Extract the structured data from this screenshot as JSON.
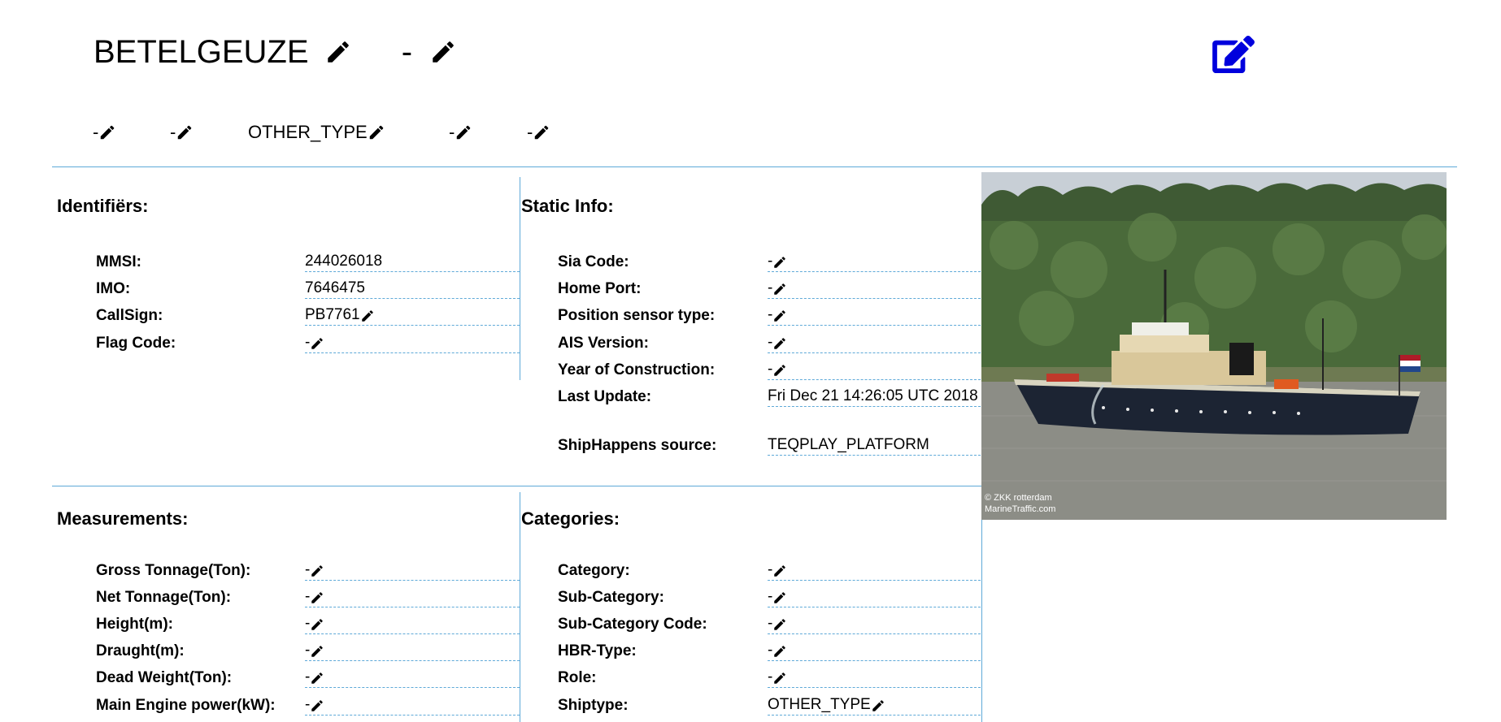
{
  "header": {
    "ship_name": "BETELGEUZE",
    "ship_name_suffix": "-"
  },
  "subheader": {
    "items": [
      {
        "value": "-"
      },
      {
        "value": "-"
      },
      {
        "value": "OTHER_TYPE"
      },
      {
        "value": "-"
      },
      {
        "value": "-"
      }
    ]
  },
  "identifiers": {
    "title": "Identifiërs:",
    "rows": [
      {
        "label": "MMSI:",
        "value": "244026018",
        "editable": false
      },
      {
        "label": "IMO:",
        "value": "7646475",
        "editable": false
      },
      {
        "label": "CallSign:",
        "value": "PB7761",
        "editable": true
      },
      {
        "label": "Flag Code:",
        "value": "-",
        "editable": true
      }
    ]
  },
  "static_info": {
    "title": "Static Info:",
    "rows": [
      {
        "label": "Sia Code:",
        "value": "-",
        "editable": true
      },
      {
        "label": "Home Port:",
        "value": "-",
        "editable": true
      },
      {
        "label": "Position sensor type:",
        "value": "-",
        "editable": true
      },
      {
        "label": "AIS Version:",
        "value": "-",
        "editable": true
      },
      {
        "label": "Year of Construction:",
        "value": "-",
        "editable": true
      },
      {
        "label": "Last Update:",
        "value": "Fri Dec 21 14:26:05 UTC 2018",
        "editable": false
      },
      {
        "label": "ShipHappens source:",
        "value": "TEQPLAY_PLATFORM",
        "editable": false
      }
    ]
  },
  "measurements": {
    "title": "Measurements:",
    "rows": [
      {
        "label": "Gross Tonnage(Ton):",
        "value": "-",
        "editable": true
      },
      {
        "label": "Net Tonnage(Ton):",
        "value": "-",
        "editable": true
      },
      {
        "label": "Height(m):",
        "value": "-",
        "editable": true
      },
      {
        "label": "Draught(m):",
        "value": "-",
        "editable": true
      },
      {
        "label": "Dead Weight(Ton):",
        "value": "-",
        "editable": true
      },
      {
        "label": "Main Engine power(kW):",
        "value": "-",
        "editable": true
      }
    ]
  },
  "categories": {
    "title": "Categories:",
    "rows": [
      {
        "label": "Category:",
        "value": "-",
        "editable": true
      },
      {
        "label": "Sub-Category:",
        "value": "-",
        "editable": true
      },
      {
        "label": "Sub-Category Code:",
        "value": "-",
        "editable": true
      },
      {
        "label": "HBR-Type:",
        "value": "-",
        "editable": true
      },
      {
        "label": "Role:",
        "value": "-",
        "editable": true
      },
      {
        "label": "Shiptype:",
        "value": "OTHER_TYPE",
        "editable": true
      }
    ]
  },
  "photo": {
    "credit_line_1": "© ZKK rotterdam",
    "credit_line_2": "MarineTraffic.com",
    "flag_colors": [
      "#ae1c28",
      "#ffffff",
      "#21468b"
    ]
  },
  "colors": {
    "edit_button": "#0000dd",
    "divider": "#5ea9d8"
  },
  "icons": {
    "inline_edit": "pencil-icon",
    "page_edit": "edit-square-icon"
  }
}
